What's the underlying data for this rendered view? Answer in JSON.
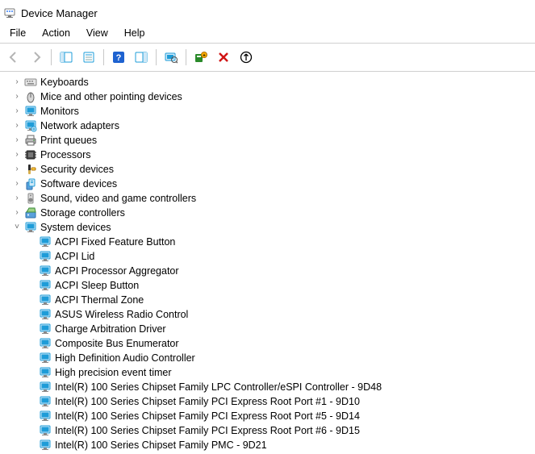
{
  "title": "Device Manager",
  "menu": [
    "File",
    "Action",
    "View",
    "Help"
  ],
  "toolbar": {
    "back": "Back",
    "forward": "Forward",
    "show_hide_tree": "Show/Hide Console Tree",
    "properties": "Properties",
    "help": "Help",
    "action_pane": "Show/Hide Action Pane",
    "scan": "Scan for hardware changes",
    "add_legacy": "Add legacy hardware",
    "remove": "Uninstall device",
    "update": "Update device driver"
  },
  "tree": [
    {
      "label": "Keyboards",
      "icon": "keyboard",
      "expanded": false
    },
    {
      "label": "Mice and other pointing devices",
      "icon": "mouse",
      "expanded": false
    },
    {
      "label": "Monitors",
      "icon": "monitor",
      "expanded": false
    },
    {
      "label": "Network adapters",
      "icon": "network",
      "expanded": false
    },
    {
      "label": "Print queues",
      "icon": "printer",
      "expanded": false
    },
    {
      "label": "Processors",
      "icon": "chip",
      "expanded": false
    },
    {
      "label": "Security devices",
      "icon": "security",
      "expanded": false
    },
    {
      "label": "Software devices",
      "icon": "software",
      "expanded": false
    },
    {
      "label": "Sound, video and game controllers",
      "icon": "sound",
      "expanded": false
    },
    {
      "label": "Storage controllers",
      "icon": "storage",
      "expanded": false
    },
    {
      "label": "System devices",
      "icon": "system",
      "expanded": true,
      "children": [
        {
          "label": "ACPI Fixed Feature Button",
          "icon": "system"
        },
        {
          "label": "ACPI Lid",
          "icon": "system"
        },
        {
          "label": "ACPI Processor Aggregator",
          "icon": "system"
        },
        {
          "label": "ACPI Sleep Button",
          "icon": "system"
        },
        {
          "label": "ACPI Thermal Zone",
          "icon": "system"
        },
        {
          "label": "ASUS Wireless Radio Control",
          "icon": "system"
        },
        {
          "label": "Charge Arbitration Driver",
          "icon": "system"
        },
        {
          "label": "Composite Bus Enumerator",
          "icon": "system"
        },
        {
          "label": "High Definition Audio Controller",
          "icon": "system"
        },
        {
          "label": "High precision event timer",
          "icon": "system"
        },
        {
          "label": "Intel(R) 100 Series Chipset Family LPC Controller/eSPI Controller - 9D48",
          "icon": "system"
        },
        {
          "label": "Intel(R) 100 Series Chipset Family PCI Express Root Port #1 - 9D10",
          "icon": "system"
        },
        {
          "label": "Intel(R) 100 Series Chipset Family PCI Express Root Port #5 - 9D14",
          "icon": "system"
        },
        {
          "label": "Intel(R) 100 Series Chipset Family PCI Express Root Port #6 - 9D15",
          "icon": "system"
        },
        {
          "label": "Intel(R) 100 Series Chipset Family PMC - 9D21",
          "icon": "system"
        }
      ]
    }
  ]
}
